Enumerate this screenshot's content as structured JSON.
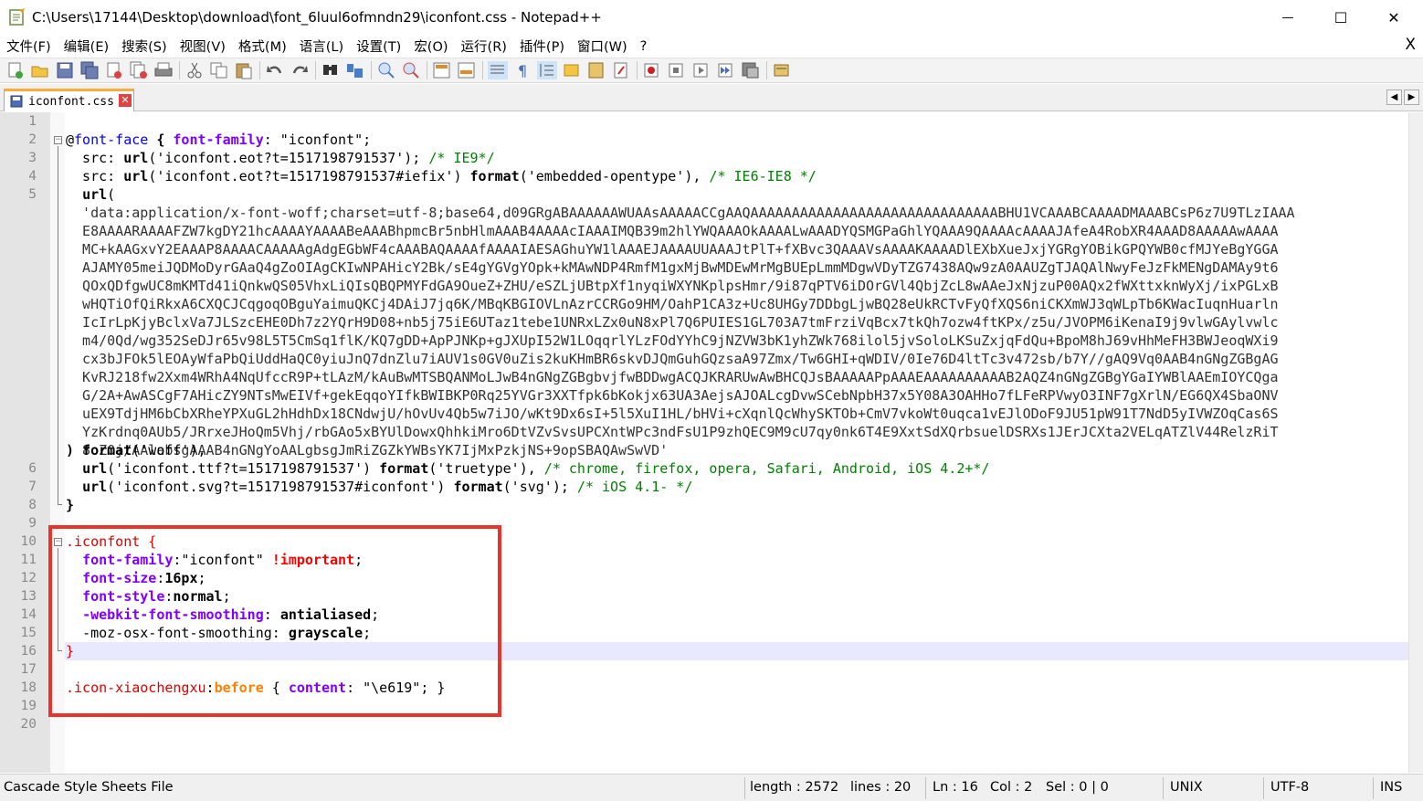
{
  "window": {
    "title": "C:\\Users\\17144\\Desktop\\download\\font_6luul6ofmndn29\\iconfont.css - Notepad++",
    "minimize_glyph": "—",
    "maximize_glyph": "☐",
    "close_glyph": "✕"
  },
  "menu": {
    "items": [
      "文件(F)",
      "编辑(E)",
      "搜索(S)",
      "视图(V)",
      "格式(M)",
      "语言(L)",
      "设置(T)",
      "宏(O)",
      "运行(R)",
      "插件(P)",
      "窗口(W)",
      "?"
    ],
    "close_glyph": "X"
  },
  "toolbar": {
    "icons": [
      "new-file",
      "open-file",
      "save",
      "save-all",
      "close",
      "close-all",
      "print",
      "cut",
      "copy",
      "paste",
      "undo",
      "redo",
      "find",
      "replace",
      "zoom-in",
      "zoom-out",
      "sync-vertical",
      "sync-horizontal",
      "word-wrap",
      "show-all-chars",
      "indent-guide",
      "user-language",
      "doc-map",
      "function-list",
      "record-macro",
      "stop-record",
      "play-macro",
      "run-macro-multiple",
      "save-macro",
      "spellcheck"
    ]
  },
  "tab": {
    "label": "iconfont.css",
    "close_glyph": "✕",
    "nav_left": "◀",
    "nav_right": "▶"
  },
  "editor": {
    "line_numbers": [
      "1",
      "2",
      "3",
      "4",
      "5",
      "6",
      "7",
      "8",
      "9",
      "10",
      "11",
      "12",
      "13",
      "14",
      "15",
      "16",
      "17",
      "18",
      "19",
      "20"
    ],
    "line2": {
      "at": "@",
      "keyword": "font-face",
      "open": " {",
      "prop": "font-family",
      "rest": ": \"iconfont\";"
    },
    "line3": {
      "indent": "  src: ",
      "fn": "url",
      "arg": "('iconfont.eot?t=1517198791537')",
      "semi": "; ",
      "comment": "/* IE9*/"
    },
    "line4": {
      "indent": "  src: ",
      "fn": "url",
      "arg": "('iconfont.eot?t=1517198791537#iefix')",
      "sp": " ",
      "fn2": "format",
      "arg2": "('embedded-opentype')",
      "comma": ", ",
      "comment": "/* IE6-IE8 */"
    },
    "line5a": {
      "indent": "  ",
      "fn": "url",
      "paren": "("
    },
    "data_lines": [
      "  'data:application/x-font-woff;charset=utf-8;base64,d09GRgABAAAAAAWUAAsAAAAACCgAAQAAAAAAAAAAAAAAAAAAAAAAAAAAAAAABHU1VCAAABCAAAADMAAABCsP6z7U9TLzIAAA",
      "  E8AAAARAAAAFZW7kgDY21hcAAAAYAAAABeAAABhpmcBr5nbHlmAAAB4AAAAcIAAAIMQB39m2hlYWQAAAOkAAAALwAAADYQSMGPaGhlYQAAA9QAAAAcAAAAJAfeA4RobXR4AAAD8AAAAAwAAAA",
      "  MC+kAAGxvY2EAAAP8AAAACAAAAAgAdgEGbWF4cAAABAQAAAAfAAAAIAESAGhuYW1lAAAEJAAAAUUAAAJtPlT+fXBvc3QAAAVsAAAAKAAAADlEXbXueJxjYGRgYOBikGPQYWB0cfMJYeBgYGGA",
      "  AJAMY05meiJQDMoDyrGAaQ4gZoOIAgCKIwNPAHicY2Bk/sE4gYGVgYOpk+kMAwNDP4RmfM1gxMjBwMDEwMrMgBUEpLmmMDgwVDyTZG7438AQw9zA0AAUZgTJAQAlNwyFeJzFkMENgDAMAy9t6",
      "  QOxQDfgwUC8mKMTd41iQnkwQS05VhxLiQIsQBQPMYFdGA9OueZ+ZHU/eSZLjUBtpXf1nyqiWXYNKplpsHmr/9i87qPTV6iDOrGVl4QbjZcL8wAAeJxNjzuP00AQx2fWXttxknWyXj/ixPGLxB",
      "  wHQTiOfQiRkxA6CXQCJCqgoqOBguYaimuQKCj4DAiJ7jq6K/MBqKBGIOVLnAzrCCRGo9HM/OahP1CA3z+Uc8UHGy7DDbgLjwBQ28eUkRCTvFyQfXQS6niCKXmWJ3qWLpTb6KWacIuqnHuarln",
      "  IcIrLpKjyBclxVa7JLSzcEHE0Dh7z2YQrH9D08+nb5j75iE6UTaz1tebe1UNRxLZx0uN8xPl7Q6PUIES1GL703A7tmFrziVqBcx7tkQh7ozw4ftKPx/z5u/JVOPM6iKenaI9j9vlwGAylvwlc",
      "  m4/0Qd/wg352SeDJr65v98L5T5CmSq1flK/KQ7gDD+ApPJNKp+gJXUpI52W1LOqqrlYLzFOdYYhC9jNZVW3bK1yhZWk768ilol5jvSoloLKSuZxjqFdQu+BpoM8hJ69vHhMeFH3BWJeoqWXi9",
      "  cx3bJFOk5lEOAyWfaPbQiUddHaQC0yiuJnQ7dnZlu7iAUV1s0GV0uZis2kuKHmBR6skvDJQmGuhGQzsaA97Zmx/Tw6GHI+qWDIV/0Ie76D4ltTc3v472sb/b7Y//gAQ9Vq0AAB4nGNgZGBgAG",
      "  KvRJ218fw2Xxm4WRhA4NqUfccR9P+tLAzM/kAuBwMTSBQANMoLJwB4nGNgZGBgbvjfwBDDwgACQJKRARUwAwBHCQJsBAAAAAPpAAAEAAAAAAAAAAB2AQZ4nGNgZGBgYGaIYWBlAAEmIOYCQga",
      "  G/2A+AwASCgF7AHicZY9NTsMwEIVf+gekEqqoYIfkBWIBKP0Rq25YVGr3XXTfpk6bKokjx63UA3AejsAJOALcgDvwSCebNpbH37x5Y08A3OAHHo7fLFeRPVwyO3INF7gXrlN/EG6QX4SbaONV",
      "  uEX9TdjHM6bCbXRheYPXuGL2hHdhDx18CNdwjU/hOvUv4Qb5w7iJO/wKt9Dx6sI+5l5XuI1HL/bHVi+cXqnlQcWhySKTOb+CmV7vkoWt0uqca1vEJlODoF9JU51pW91T7NdD5yIVWZOqCas6S",
      "  YzKrdnq0AUb5/JRrxeJHoQm5Vhj/rbGAo5xBYUlDowxQhhkiMro6DtVZvSvsUPCXntWPc3ndFsU1P9zhQEC9M9cU7qy0nk6T4E9XxtSdXQrbsuelDSRXs1JErJCXta2VELqATZlV44RelzRiT",
      "  8oZ0j/AAlabsgAAAB4nGNgYoAALgbsgJmRiZGZkYWBsYK7IjMxPzkjNS+9opSBAQAwSwVD'"
    ],
    "data_last": {
      "close": ")",
      "sp": " ",
      "fn": "format",
      "arg": "('woff')",
      "comma": ","
    },
    "line6": {
      "indent": "  ",
      "fn": "url",
      "arg": "('iconfont.ttf?t=1517198791537')",
      "sp": " ",
      "fn2": "format",
      "arg2": "('truetype')",
      "comma": ", ",
      "comment": "/* chrome, firefox, opera, Safari, Android, iOS 4.2+*/"
    },
    "line7": {
      "indent": "  ",
      "fn": "url",
      "arg": "('iconfont.svg?t=1517198791537#iconfont')",
      "sp": " ",
      "fn2": "format",
      "arg2": "('svg')",
      "semi": "; ",
      "comment": "/* iOS 4.1- */"
    },
    "line8": "}",
    "line10": {
      "selector": ".iconfont",
      "open": " {"
    },
    "line11": {
      "indent": "  ",
      "prop": "font-family",
      "colon": ":\"iconfont\" ",
      "important": "!important",
      "semi": ";"
    },
    "line12": {
      "indent": "  ",
      "prop": "font-size",
      "colon": ":",
      "value": "16px",
      "semi": ";"
    },
    "line13": {
      "indent": "  ",
      "prop": "font-style",
      "colon": ":",
      "value": "normal",
      "semi": ";"
    },
    "line14": {
      "indent": "  ",
      "prop": "-webkit-font-smoothing",
      "colon": ": ",
      "value": "antialiased",
      "semi": ";"
    },
    "line15": {
      "indent": "  ",
      "prop": "-moz-osx-font-smoothing",
      "colon": ": ",
      "value": "grayscale",
      "semi": ";"
    },
    "line16": "}",
    "line18": {
      "selector": ".icon-xiaochengxu",
      "colon": ":",
      "pseudo": "before",
      "open": " { ",
      "prop": "content",
      "rest": ": \"\\e619\"; ",
      "close": "}"
    }
  },
  "status": {
    "file_type": "Cascade Style Sheets File",
    "length": "length : 2572",
    "lines": "lines : 20",
    "ln": "Ln : 16",
    "col": "Col : 2",
    "sel": "Sel : 0 | 0",
    "eol": "UNIX",
    "encoding": "UTF-8",
    "mode": "INS"
  },
  "colors": {
    "highlight_box": "#e8342a",
    "tab_accent": "#fbaa3c",
    "current_line": "#e8e8ff"
  }
}
